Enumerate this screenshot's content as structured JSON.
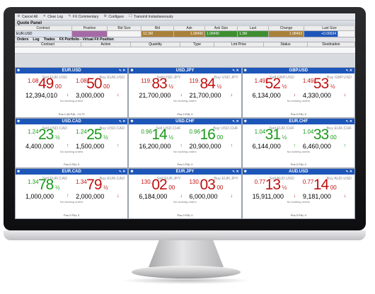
{
  "toolbar": {
    "items": [
      {
        "label": "Cancel All",
        "icon": "cancel-icon"
      },
      {
        "label": "Clear Log",
        "icon": "clear-icon"
      },
      {
        "label": "FX Commentary",
        "icon": "commentary-icon"
      },
      {
        "label": "Configure",
        "icon": "wrench-icon"
      },
      {
        "label": "Transmit Instantaneously",
        "icon": "checkbox-icon"
      }
    ]
  },
  "quote_panel": {
    "title": "Quote Panel",
    "columns": [
      "Contract",
      "Position",
      "Bid Size",
      "Bid",
      "Ask",
      "Ask Size",
      "Last",
      "Change",
      "Last Size"
    ],
    "row": {
      "contract": "EUR.USD",
      "position": "",
      "bid_size": "12.3M",
      "bid": "1.08490",
      "ask": "1.08495",
      "ask_size": "1.3M",
      "last": "1.08493",
      "change": "+0.00034",
      "last_size": ""
    }
  },
  "tabs": [
    "Orders",
    "Log",
    "Trades",
    "FX Portfolio - Virtual FX Position"
  ],
  "orders_columns": [
    "Contract",
    "Action",
    "Quantity",
    "Type",
    "Lmt Price",
    "Status",
    "Destination"
  ],
  "tiles": [
    {
      "pair": "EUR.USD",
      "sell": {
        "label": "Sell EUR.USD",
        "small": "1.08",
        "big": "49",
        "frac": "00",
        "size": "12,394,010",
        "dir": "down"
      },
      "buy": {
        "label": "Buy EUR.USD",
        "small": "1.08",
        "big": "50",
        "frac": "00",
        "size": "3,000,000",
        "dir": "down"
      },
      "nowork": "No working orders",
      "pos": "Pos  1.08    P&L  -74.72"
    },
    {
      "pair": "USD.JPY",
      "sell": {
        "label": "Sell USD.JPY",
        "small": "119.",
        "big": "83",
        "frac": "½",
        "size": "21,700,000",
        "dir": "down"
      },
      "buy": {
        "label": "Buy USD.JPY",
        "small": "119.",
        "big": "84",
        "frac": "½",
        "size": "21,700,000",
        "dir": "down"
      },
      "nowork": "No working orders",
      "pos": "Pos   0    P&L   0"
    },
    {
      "pair": "GBP.USD",
      "sell": {
        "label": "Sell GBP.USD",
        "small": "1.49",
        "big": "52",
        "frac": "½",
        "size": "6,134,000",
        "dir": "down"
      },
      "buy": {
        "label": "Buy GBP.USD",
        "small": "1.49",
        "big": "53",
        "frac": "½",
        "size": "4,330,000",
        "dir": "down"
      },
      "nowork": "No working orders",
      "pos": "Pos   0    P&L   0"
    },
    {
      "pair": "USD.CAD",
      "sell": {
        "label": "Sell USD.CAD",
        "small": "1.24",
        "big": "23",
        "frac": "½",
        "size": "4,400,000",
        "dir": "up"
      },
      "buy": {
        "label": "Buy USD.CAD",
        "small": "1.24",
        "big": "25",
        "frac": "½",
        "size": "1,500,000",
        "dir": "up"
      },
      "nowork": "No working orders",
      "pos": "Pos   0    P&L   0"
    },
    {
      "pair": "USD.CHF",
      "sell": {
        "label": "Sell USD.CHF",
        "small": "0.96",
        "big": "14",
        "frac": "½",
        "size": "16,200,000",
        "dir": "up"
      },
      "buy": {
        "label": "Buy USD.CHF",
        "small": "0.96",
        "big": "16",
        "frac": "00",
        "size": "20,900,000",
        "dir": "up"
      },
      "nowork": "No working orders",
      "pos": "Pos   0    P&L   0"
    },
    {
      "pair": "EUR.CHF",
      "sell": {
        "label": "Sell EUR.CHF",
        "small": "1.04",
        "big": "31",
        "frac": "½",
        "size": "6,144,000",
        "dir": "up"
      },
      "buy": {
        "label": "Buy EUR.CHF",
        "small": "1.04",
        "big": "33",
        "frac": "00",
        "size": "6,460,000",
        "dir": "up"
      },
      "nowork": "No working orders",
      "pos": "Pos   0    P&L   0"
    },
    {
      "pair": "EUR.CAD",
      "sell": {
        "label": "Sell EUR.CAD",
        "small": "1.34",
        "big": "78",
        "frac": "½",
        "size": "1,000,000",
        "dir": "up"
      },
      "buy": {
        "label": "Buy EUR.CAD",
        "small": "1.34",
        "big": "79",
        "frac": "½",
        "size": "2,000,000",
        "dir": "down"
      },
      "nowork": "No working orders",
      "pos": "Pos   0    P&L   0"
    },
    {
      "pair": "EUR.JPY",
      "sell": {
        "label": "Sell EUR.JPY",
        "small": "130.",
        "big": "02",
        "frac": "00",
        "size": "6,184,000",
        "dir": "down"
      },
      "buy": {
        "label": "Buy EUR.JPY",
        "small": "130.",
        "big": "03",
        "frac": "00",
        "size": "6,000,000",
        "dir": "down"
      },
      "nowork": "No working orders",
      "pos": "Pos   0    P&L   0"
    },
    {
      "pair": "AUD.USD",
      "sell": {
        "label": "Sell AUD.USD",
        "small": "0.77",
        "big": "13",
        "frac": "½",
        "size": "15,911,000",
        "dir": "down"
      },
      "buy": {
        "label": "Buy AUD.USD",
        "small": "0.77",
        "big": "14",
        "frac": "00",
        "size": "9,181,000",
        "dir": "down"
      },
      "nowork": "No working orders",
      "pos": "Pos   0    P&L   0"
    }
  ],
  "colors": {
    "up": "#1a9a19",
    "down": "#c01010",
    "header": "#1d56b9",
    "bid_bg": "#a9813a",
    "ask_bg": "#3f8f30",
    "change_bg": "#1d56b9",
    "position_bg": "#a56aa6"
  }
}
